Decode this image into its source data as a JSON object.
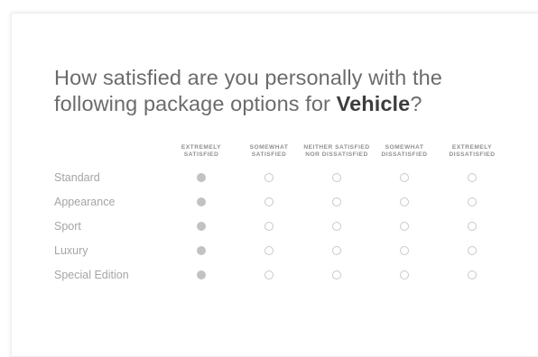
{
  "question": {
    "prefix": "How satisfied are you personally with the following package options for ",
    "emphasis": "Vehicle",
    "suffix": "?"
  },
  "columns": [
    {
      "line1": "EXTREMELY",
      "line2": "SATISFIED"
    },
    {
      "line1": "SOMEWHAT",
      "line2": "SATISFIED"
    },
    {
      "line1": "NEITHER SATISFIED",
      "line2": "NOR DISSATISFIED"
    },
    {
      "line1": "SOMEWHAT",
      "line2": "DISSATISFIED"
    },
    {
      "line1": "EXTREMELY",
      "line2": "DISSATISFIED"
    }
  ],
  "rows": [
    {
      "label": "Standard",
      "selected": 0
    },
    {
      "label": "Appearance",
      "selected": 0
    },
    {
      "label": "Sport",
      "selected": 0
    },
    {
      "label": "Luxury",
      "selected": 0
    },
    {
      "label": "Special Edition",
      "selected": 0
    }
  ],
  "colors": {
    "selected_fill": "#c2c2c2",
    "radio_border": "#c8c8c8",
    "label_text": "#a5a5a5",
    "question_text": "#6b6b6b"
  }
}
